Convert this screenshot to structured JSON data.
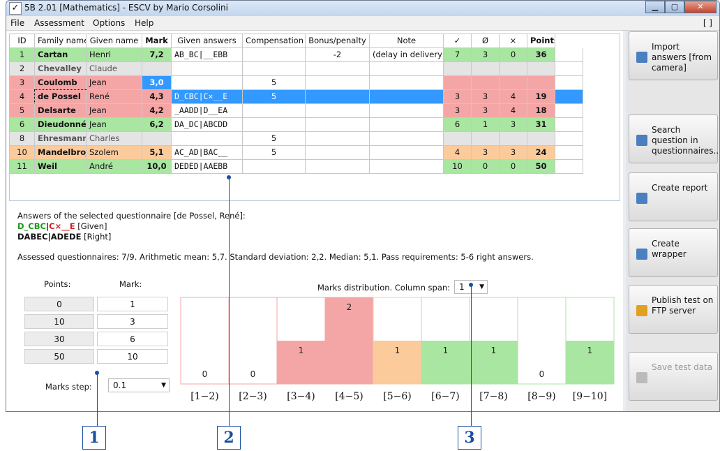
{
  "window": {
    "title": "5B 2.01 [Mathematics] - ESCV by Mario Corsolini",
    "check_glyph": "✓",
    "min": "▁",
    "max": "▢",
    "close": "✕"
  },
  "menu": {
    "items": [
      "File",
      "Assessment",
      "Options",
      "Help"
    ],
    "right": "[ ]"
  },
  "grid": {
    "columns": [
      "ID",
      "Family name",
      "Given name",
      "Mark",
      "Given answers",
      "Compensation",
      "Bonus/penalty",
      "Note",
      "✓",
      "Ø",
      "×",
      "Points"
    ],
    "rows": [
      {
        "id": "1",
        "family": "Cartan",
        "given": "Henri",
        "mark": "7,2",
        "answers": "AB_BC|__EBB",
        "comp": "",
        "bonus": "-2",
        "note": "(delay in delivery)",
        "ok": "7",
        "empty": "3",
        "wrong": "0",
        "points": "36",
        "tone": "green"
      },
      {
        "id": "2",
        "family": "Chevalley",
        "given": "Claude",
        "mark": "",
        "answers": "",
        "comp": "",
        "bonus": "",
        "note": "",
        "ok": "",
        "empty": "",
        "wrong": "",
        "points": "",
        "tone": "gray"
      },
      {
        "id": "3",
        "family": "Coulomb",
        "given": "Jean",
        "mark": "3,0",
        "answers": "",
        "comp": "5",
        "bonus": "",
        "note": "",
        "ok": "",
        "empty": "",
        "wrong": "",
        "points": "",
        "tone": "red"
      },
      {
        "id": "4",
        "family": "de Possel",
        "given": "René",
        "mark": "4,3",
        "answers": "D_CBC|C×__E",
        "comp": "5",
        "bonus": "",
        "note": "",
        "ok": "3",
        "empty": "3",
        "wrong": "4",
        "points": "19",
        "tone": "red"
      },
      {
        "id": "5",
        "family": "Delsarte",
        "given": "Jean",
        "mark": "4,2",
        "answers": "_AADD|D__EA",
        "comp": "",
        "bonus": "",
        "note": "",
        "ok": "3",
        "empty": "3",
        "wrong": "4",
        "points": "18",
        "tone": "red"
      },
      {
        "id": "6",
        "family": "Dieudonné",
        "given": "Jean",
        "mark": "6,2",
        "answers": "DA_DC|ABCDD",
        "comp": "",
        "bonus": "",
        "note": "",
        "ok": "6",
        "empty": "1",
        "wrong": "3",
        "points": "31",
        "tone": "green"
      },
      {
        "id": "8",
        "family": "Ehresmann",
        "given": "Charles",
        "mark": "",
        "answers": "",
        "comp": "5",
        "bonus": "",
        "note": "",
        "ok": "",
        "empty": "",
        "wrong": "",
        "points": "",
        "tone": "gray"
      },
      {
        "id": "10",
        "family": "Mandelbrojt",
        "given": "Szolem",
        "mark": "5,1",
        "answers": "AC_AD|BAC__",
        "comp": "5",
        "bonus": "",
        "note": "",
        "ok": "4",
        "empty": "3",
        "wrong": "3",
        "points": "24",
        "tone": "orange"
      },
      {
        "id": "11",
        "family": "Weil",
        "given": "André",
        "mark": "10,0",
        "answers": "DEDED|AAEBB",
        "comp": "",
        "bonus": "",
        "note": "",
        "ok": "10",
        "empty": "0",
        "wrong": "0",
        "points": "50",
        "tone": "green"
      }
    ]
  },
  "details": {
    "heading": "Answers of the selected questionnaire [de Possel, René]:",
    "given_a": "D_CBC",
    "given_sep": "|",
    "given_b": "C×__E",
    "given_tag": " [Given]",
    "right_a": "DABEC",
    "right_sep": "|",
    "right_b": "ADEDE",
    "right_tag": " [Right]",
    "stats": "Assessed questionnaires: 7/9. Arithmetic mean: 5,7. Standard deviation: 2,2. Median: 5,1. Pass requirements: 5-6 right answers."
  },
  "points_table": {
    "points_header": "Points:",
    "mark_header": "Mark:",
    "rows": [
      {
        "points": "0",
        "mark": "1"
      },
      {
        "points": "10",
        "mark": "3"
      },
      {
        "points": "30",
        "mark": "6"
      },
      {
        "points": "50",
        "mark": "10"
      }
    ],
    "step_label": "Marks step:",
    "step_value": "0.1"
  },
  "distribution": {
    "label": "Marks distribution. Column span:",
    "span_value": "1"
  },
  "chart_data": {
    "type": "bar",
    "categories": [
      "[1−2)",
      "[2−3)",
      "[3−4)",
      "[4−5)",
      "[5−6)",
      "[6−7)",
      "[7−8)",
      "[8−9)",
      "[9−10]"
    ],
    "values": [
      0,
      0,
      1,
      2,
      1,
      1,
      1,
      0,
      1
    ],
    "colors": [
      "#f4a6a6",
      "#f4a6a6",
      "#f4a6a6",
      "#f4a6a6",
      "#fbcb9c",
      "#a8e6a1",
      "#a8e6a1",
      "#a8e6a1",
      "#a8e6a1"
    ],
    "ylim": [
      0,
      2
    ]
  },
  "sidebar": {
    "buttons": [
      {
        "label": "Import answers [from camera]",
        "icon": "camera-icon",
        "color": "#4a7fc0"
      },
      {
        "label": "Search question in questionnaires...",
        "icon": "search-icon",
        "color": "#4a7fc0"
      },
      {
        "label": "Create report",
        "icon": "report-icon",
        "color": "#4a7fc0"
      },
      {
        "label": "Create wrapper",
        "icon": "wrapper-icon",
        "color": "#4a7fc0"
      },
      {
        "label": "Publish test on FTP server",
        "icon": "globe-icon",
        "color": "#e0a020"
      },
      {
        "label": "Save test data",
        "icon": "save-icon",
        "color": "#bbbbbb"
      }
    ]
  },
  "callouts": [
    "1",
    "2",
    "3"
  ]
}
